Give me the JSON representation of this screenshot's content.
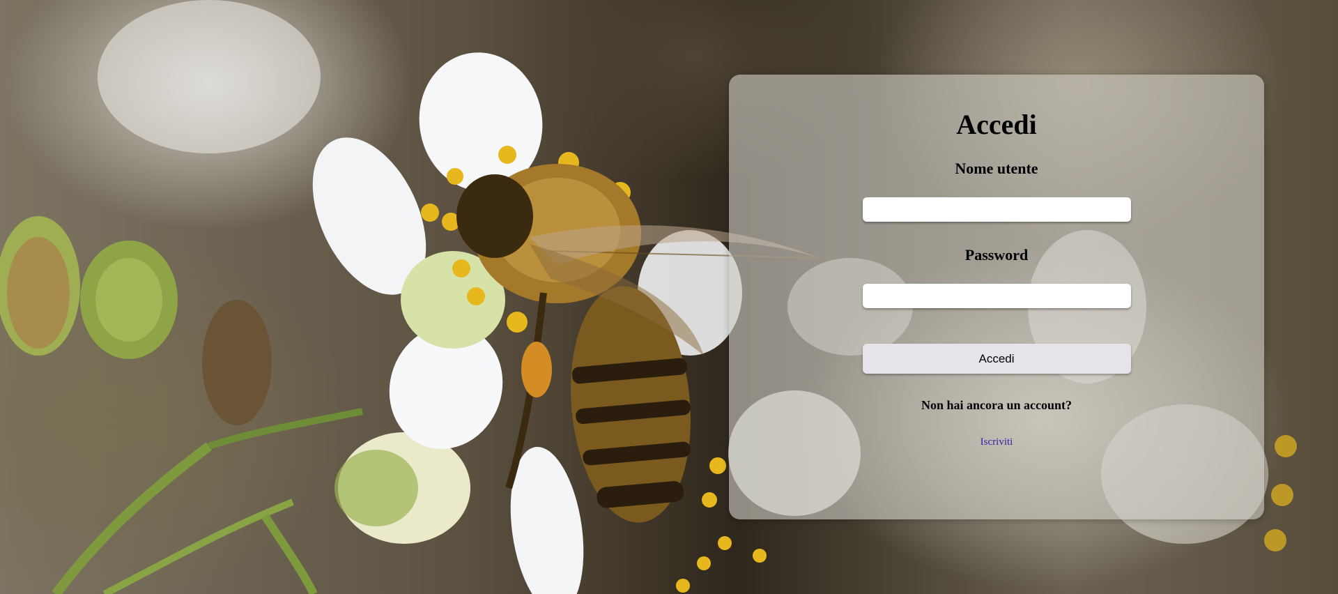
{
  "login": {
    "title": "Accedi",
    "username_label": "Nome utente",
    "username_value": "",
    "password_label": "Password",
    "password_value": "",
    "submit_label": "Accedi",
    "no_account_text": "Non hai ancora un account?",
    "signup_link": "Iscriviti"
  },
  "colors": {
    "card_background": "#cdcbc4",
    "button_background": "#e6e4ea",
    "link": "#3a1fa0"
  }
}
